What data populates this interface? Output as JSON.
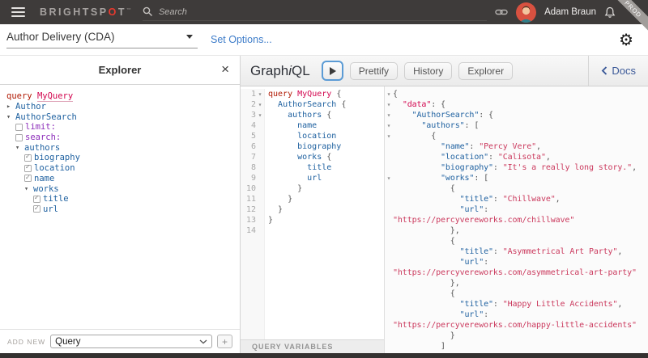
{
  "colors": {
    "accent_blue": "#1F61A0",
    "keyword_red": "#B11A04",
    "def_pink": "#D2054E",
    "string_red": "#CB3A5E",
    "arg_purple": "#8B2BB9",
    "topbar_bg": "#3e3b3a",
    "docs_blue": "#3B5998",
    "logo_red": "#e8392e"
  },
  "glyphs": {
    "check": "✓",
    "arrow_down": "▾",
    "arrow_right": "▸",
    "fold": "▾",
    "close": "×",
    "gear": "⚙"
  },
  "topbar": {
    "logo_prefix": "BRIGHTSP",
    "logo_o": "O",
    "logo_suffix": "T",
    "logo_tm": "™",
    "search_placeholder": "Search",
    "user_name": "Adam Braun",
    "env_badge": "PROD"
  },
  "toolbar": {
    "source_select": "Author Delivery (CDA)",
    "set_options_label": "Set Options..."
  },
  "explorer": {
    "title": "Explorer",
    "tree": [
      {
        "m": "none",
        "i": 0,
        "t": [
          [
            "k",
            "query "
          ],
          [
            "du",
            "MyQuery"
          ]
        ]
      },
      {
        "m": "right",
        "i": 0,
        "t": [
          [
            "p",
            "Author"
          ]
        ]
      },
      {
        "m": "down",
        "i": 0,
        "t": [
          [
            "p",
            "AuthorSearch"
          ]
        ]
      },
      {
        "m": "box",
        "i": 1,
        "t": [
          [
            "a",
            "limit:"
          ]
        ]
      },
      {
        "m": "box",
        "i": 1,
        "t": [
          [
            "a",
            "search:"
          ]
        ]
      },
      {
        "m": "down",
        "i": 1,
        "t": [
          [
            "p",
            "authors"
          ]
        ]
      },
      {
        "m": "boxck",
        "i": 2,
        "t": [
          [
            "p",
            "biography"
          ]
        ]
      },
      {
        "m": "boxck",
        "i": 2,
        "t": [
          [
            "p",
            "location"
          ]
        ]
      },
      {
        "m": "boxck",
        "i": 2,
        "t": [
          [
            "p",
            "name"
          ]
        ]
      },
      {
        "m": "down",
        "i": 2,
        "t": [
          [
            "p",
            "works"
          ]
        ]
      },
      {
        "m": "boxck",
        "i": 3,
        "t": [
          [
            "p",
            "title"
          ]
        ]
      },
      {
        "m": "boxck",
        "i": 3,
        "t": [
          [
            "p",
            "url"
          ]
        ]
      }
    ],
    "footer": {
      "add_label": "ADD NEW",
      "select_value": "Query",
      "plus_label": "+"
    }
  },
  "graphiql": {
    "title_graph": "Graph",
    "title_i": "i",
    "title_ql": "QL",
    "buttons": [
      "Prettify",
      "History",
      "Explorer"
    ],
    "docs_label": "Docs",
    "variables_label": "QUERY VARIABLES"
  },
  "query_editor": {
    "fold_lines": [
      1,
      2,
      3
    ],
    "lines": [
      [
        [
          "k",
          "query"
        ],
        [
          "n",
          " "
        ],
        [
          "d",
          "MyQuery"
        ],
        [
          "n",
          " {"
        ]
      ],
      [
        [
          "n",
          "  "
        ],
        [
          "p",
          "AuthorSearch"
        ],
        [
          "n",
          " {"
        ]
      ],
      [
        [
          "n",
          "    "
        ],
        [
          "p",
          "authors"
        ],
        [
          "n",
          " {"
        ]
      ],
      [
        [
          "n",
          "      "
        ],
        [
          "p",
          "name"
        ]
      ],
      [
        [
          "n",
          "      "
        ],
        [
          "p",
          "location"
        ]
      ],
      [
        [
          "n",
          "      "
        ],
        [
          "p",
          "biography"
        ]
      ],
      [
        [
          "n",
          "      "
        ],
        [
          "p",
          "works"
        ],
        [
          "n",
          " {"
        ]
      ],
      [
        [
          "n",
          "        "
        ],
        [
          "p",
          "title"
        ]
      ],
      [
        [
          "n",
          "        "
        ],
        [
          "p",
          "url"
        ]
      ],
      [
        [
          "n",
          "      }"
        ]
      ],
      [
        [
          "n",
          "    }"
        ]
      ],
      [
        [
          "n",
          "  }"
        ]
      ],
      [
        [
          "n",
          "}"
        ]
      ],
      []
    ]
  },
  "result_viewer": {
    "fold_lines": [
      1,
      2,
      3,
      4,
      5,
      9
    ],
    "lines": [
      [
        [
          "n",
          "{"
        ]
      ],
      [
        [
          "n",
          "  "
        ],
        [
          "d",
          "\"data\""
        ],
        [
          "n",
          ": {"
        ]
      ],
      [
        [
          "n",
          "    "
        ],
        [
          "p",
          "\"AuthorSearch\""
        ],
        [
          "n",
          ": {"
        ]
      ],
      [
        [
          "n",
          "      "
        ],
        [
          "p",
          "\"authors\""
        ],
        [
          "n",
          ": ["
        ]
      ],
      [
        [
          "n",
          "        {"
        ]
      ],
      [
        [
          "n",
          "          "
        ],
        [
          "p",
          "\"name\""
        ],
        [
          "n",
          ": "
        ],
        [
          "s",
          "\"Percy Vere\""
        ],
        [
          "n",
          ","
        ]
      ],
      [
        [
          "n",
          "          "
        ],
        [
          "p",
          "\"location\""
        ],
        [
          "n",
          ": "
        ],
        [
          "s",
          "\"Calisota\""
        ],
        [
          "n",
          ","
        ]
      ],
      [
        [
          "n",
          "          "
        ],
        [
          "p",
          "\"biography\""
        ],
        [
          "n",
          ": "
        ],
        [
          "s",
          "\"It's a really long story.\""
        ],
        [
          "n",
          ","
        ]
      ],
      [
        [
          "n",
          "          "
        ],
        [
          "p",
          "\"works\""
        ],
        [
          "n",
          ": ["
        ]
      ],
      [
        [
          "n",
          "            {"
        ]
      ],
      [
        [
          "n",
          "              "
        ],
        [
          "p",
          "\"title\""
        ],
        [
          "n",
          ": "
        ],
        [
          "s",
          "\"Chillwave\""
        ],
        [
          "n",
          ","
        ]
      ],
      [
        [
          "n",
          "              "
        ],
        [
          "p",
          "\"url\""
        ],
        [
          "n",
          ":"
        ]
      ],
      [
        [
          "s",
          "\"https://percyvereworks.com/chillwave\""
        ]
      ],
      [
        [
          "n",
          "            },"
        ]
      ],
      [
        [
          "n",
          "            {"
        ]
      ],
      [
        [
          "n",
          "              "
        ],
        [
          "p",
          "\"title\""
        ],
        [
          "n",
          ": "
        ],
        [
          "s",
          "\"Asymmetrical Art Party\""
        ],
        [
          "n",
          ","
        ]
      ],
      [
        [
          "n",
          "              "
        ],
        [
          "p",
          "\"url\""
        ],
        [
          "n",
          ":"
        ]
      ],
      [
        [
          "s",
          "\"https://percyvereworks.com/asymmetrical-art-party\""
        ]
      ],
      [
        [
          "n",
          "            },"
        ]
      ],
      [
        [
          "n",
          "            {"
        ]
      ],
      [
        [
          "n",
          "              "
        ],
        [
          "p",
          "\"title\""
        ],
        [
          "n",
          ": "
        ],
        [
          "s",
          "\"Happy Little Accidents\""
        ],
        [
          "n",
          ","
        ]
      ],
      [
        [
          "n",
          "              "
        ],
        [
          "p",
          "\"url\""
        ],
        [
          "n",
          ":"
        ]
      ],
      [
        [
          "s",
          "\"https://percyvereworks.com/happy-little-accidents\""
        ]
      ],
      [
        [
          "n",
          "            }"
        ]
      ],
      [
        [
          "n",
          "          ]"
        ]
      ]
    ]
  }
}
